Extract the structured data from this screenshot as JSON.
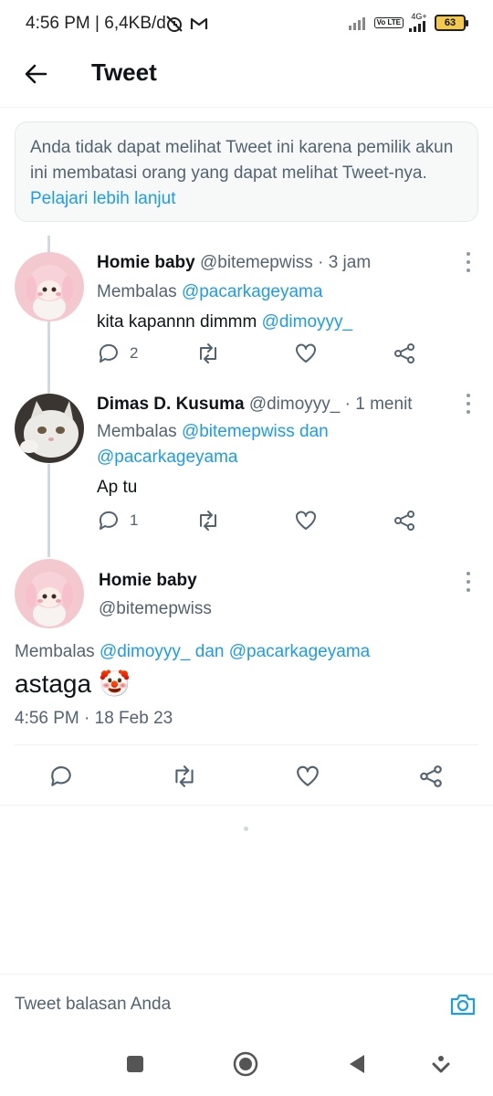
{
  "status_bar": {
    "time_speed": "4:56 PM | 6,4KB/d",
    "volte_label": "Vo LTE",
    "network_label": "4G+",
    "battery": "63"
  },
  "header": {
    "title": "Tweet"
  },
  "notice": {
    "text": "Anda tidak dapat melihat Tweet ini karena pemilik akun ini membatasi orang yang dapat melihat Tweet-nya.",
    "link": "Pelajari lebih lanjut"
  },
  "tweets": [
    {
      "name": "Homie baby",
      "handle": "@bitemepwiss",
      "time": "· 3 jam",
      "reply_prefix": "Membalas",
      "reply_to": "@pacarkageyama",
      "text": "kita kapannn dimmm",
      "mention": "@dimoyyy_",
      "reply_count": "2"
    },
    {
      "name": "Dimas D. Kusuma",
      "handle": "@dimoyyy_",
      "time": "· 1 menit",
      "reply_prefix": "Membalas",
      "reply_to": "@bitemepwiss dan",
      "reply_to_2": "@pacarkageyama",
      "text": "Ap tu",
      "reply_count": "1"
    }
  ],
  "main_tweet": {
    "name": "Homie baby",
    "handle": "@bitemepwiss",
    "reply_prefix": "Membalas",
    "reply_to": "@dimoyyy_ dan @pacarkageyama",
    "text": "astaga",
    "emoji": "🤡",
    "timestamp": "4:56 PM · 18 Feb 23"
  },
  "reply_bar": {
    "placeholder": "Tweet balasan Anda"
  },
  "colors": {
    "link": "#1d9bf0",
    "secondary_text": "#536471",
    "border": "#eff3f4"
  }
}
